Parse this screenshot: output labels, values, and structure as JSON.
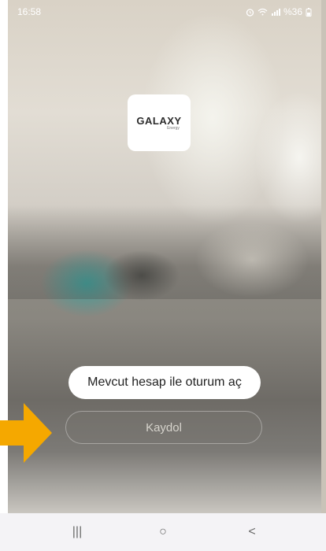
{
  "status_bar": {
    "time": "16:58",
    "battery_text": "%36",
    "icons": [
      "alarm-icon",
      "wifi-icon",
      "signal-icon",
      "battery-icon"
    ]
  },
  "logo": {
    "brand": "GALAXY",
    "sub": "Energy"
  },
  "actions": {
    "login_label": "Mevcut hesap ile oturum aç",
    "signup_label": "Kaydol"
  },
  "annotation": {
    "arrow_color": "#f5a800"
  },
  "nav_bar": {
    "recent": "|||",
    "home": "○",
    "back": "<"
  }
}
